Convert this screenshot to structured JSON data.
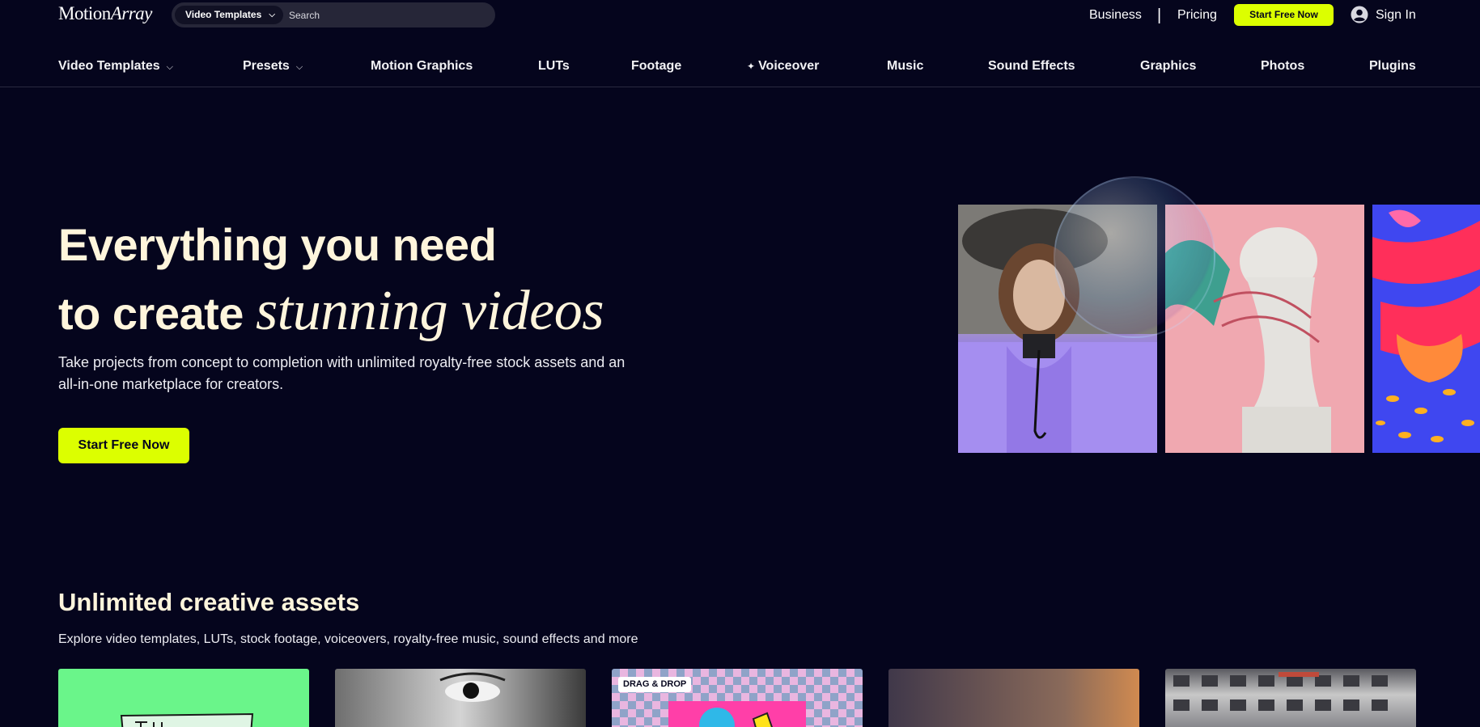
{
  "brand": {
    "logo_regular": "Motion",
    "logo_italic": "Array"
  },
  "search": {
    "category": "Video Templates",
    "placeholder": "Search"
  },
  "top_links": {
    "business": "Business",
    "divider": "|",
    "pricing": "Pricing",
    "start": "Start Free Now",
    "signin": "Sign In"
  },
  "nav": {
    "items": [
      {
        "label": "Video Templates"
      },
      {
        "label": "Presets"
      },
      {
        "label": "Motion Graphics"
      },
      {
        "label": "LUTs"
      },
      {
        "label": "Footage"
      },
      {
        "label": "Voiceover"
      },
      {
        "label": "Music"
      },
      {
        "label": "Sound Effects"
      },
      {
        "label": "Graphics"
      },
      {
        "label": "Photos"
      },
      {
        "label": "Plugins"
      }
    ]
  },
  "hero": {
    "line1": "Everything you need",
    "line2_plain": "to create ",
    "line2_serif": "stunning videos",
    "subtitle": "Take projects from concept to completion with unlimited royalty-free stock assets and an all-in-one marketplace for creators.",
    "cta": "Start Free Now"
  },
  "section": {
    "title": "Unlimited creative assets",
    "subtitle": "Explore video templates, LUTs, stock footage, voiceovers, royalty-free music, sound effects and more",
    "card_badge": "DRAG & DROP"
  },
  "colors": {
    "background": "#05051d",
    "accent": "#dcff00",
    "heading": "#fff5dc"
  }
}
